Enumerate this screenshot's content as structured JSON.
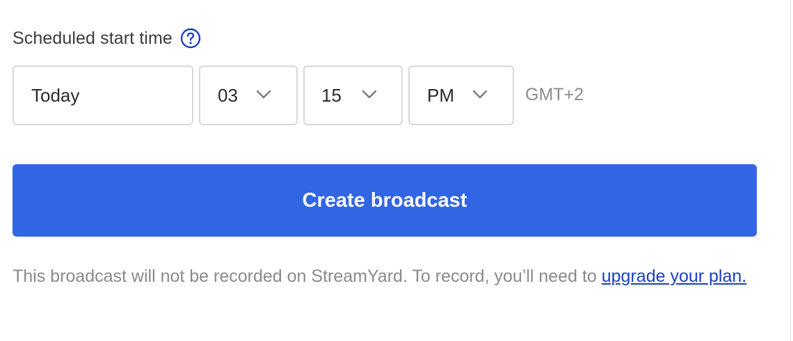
{
  "schedule": {
    "label": "Scheduled start time",
    "help_icon": "question-circle-icon",
    "date_value": "Today",
    "hour_value": "03",
    "minute_value": "15",
    "ampm_value": "PM",
    "chevron_icon": "chevron-down-icon",
    "timezone": "GMT+2"
  },
  "actions": {
    "create_label": "Create broadcast"
  },
  "notice": {
    "text": "This broadcast will not be recorded on StreamYard. To record, you’ll need to ",
    "link_text": "upgrade your plan."
  },
  "colors": {
    "primary": "#3165e3",
    "link": "#1a3fc4",
    "border": "#d8d8d8",
    "muted_text": "#8a8a8a"
  }
}
